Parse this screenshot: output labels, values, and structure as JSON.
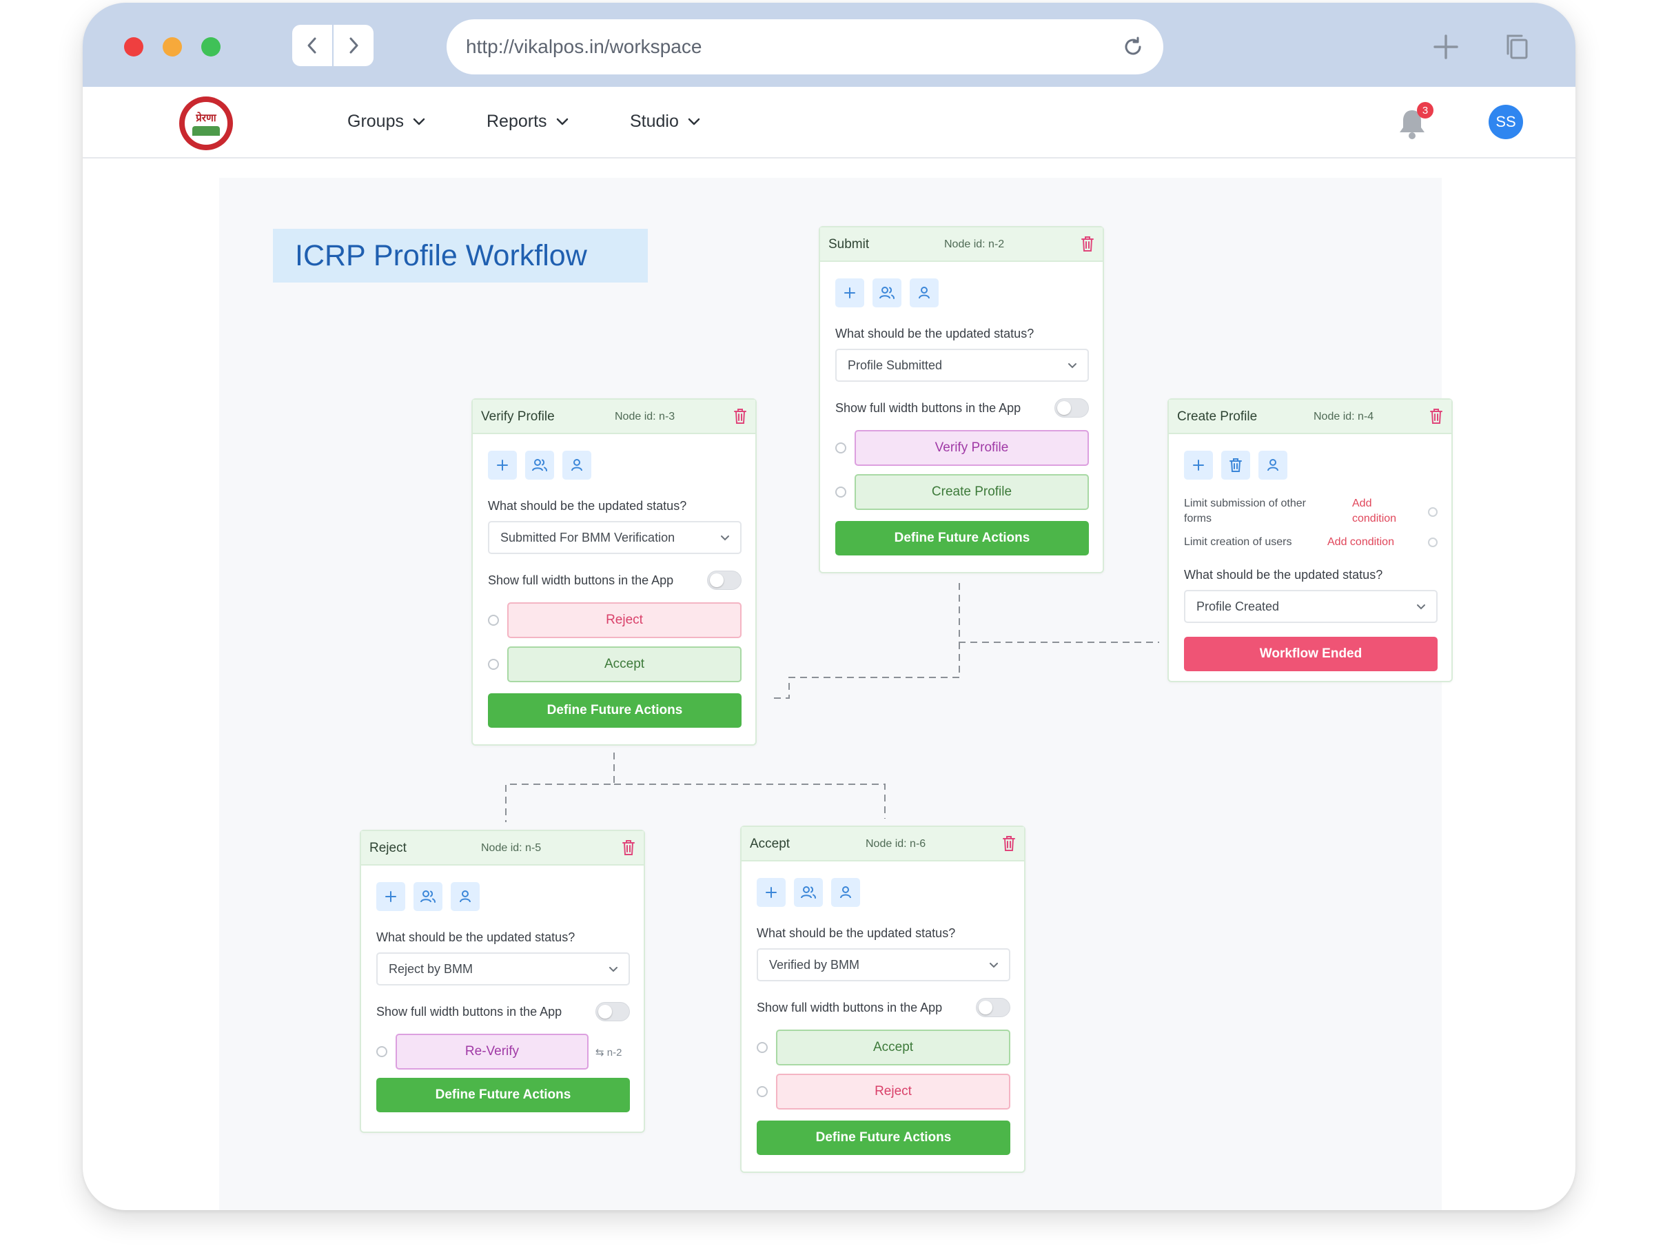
{
  "browser": {
    "url": "http://vikalpos.in/workspace",
    "dots": [
      "#ef3f3f",
      "#f6a93b",
      "#3fc157"
    ]
  },
  "header": {
    "logo_text": "प्रेरणा",
    "menu": [
      {
        "label": "Groups"
      },
      {
        "label": "Reports"
      },
      {
        "label": "Studio"
      }
    ],
    "notification_count": "3",
    "avatar_initials": "SS"
  },
  "workflow": {
    "title": "ICRP Profile Workflow",
    "question": "What should be the updated status?",
    "toggle_label": "Show full width buttons in the App",
    "define_label": "Define Future Actions",
    "nodes": {
      "submit": {
        "title": "Submit",
        "node_id": "Node id: n-2",
        "status": "Profile Submitted",
        "options": [
          "Verify Profile",
          "Create Profile"
        ]
      },
      "verify": {
        "title": "Verify Profile",
        "node_id": "Node id: n-3",
        "status": "Submitted For BMM Verification",
        "options": [
          "Reject",
          "Accept"
        ]
      },
      "create": {
        "title": "Create Profile",
        "node_id": "Node id: n-4",
        "conditions": [
          {
            "label": "Limit submission of other forms",
            "link": "Add condition"
          },
          {
            "label": "Limit creation of users",
            "link": "Add condition"
          }
        ],
        "status": "Profile Created",
        "end_label": "Workflow Ended"
      },
      "reject": {
        "title": "Reject",
        "node_id": "Node id: n-5",
        "status": "Reject by BMM",
        "options": [
          "Re-Verify"
        ],
        "goto": "⇆ n-2"
      },
      "accept": {
        "title": "Accept",
        "node_id": "Node id: n-6",
        "status": "Verified by BMM",
        "options": [
          "Accept",
          "Reject"
        ]
      }
    }
  }
}
